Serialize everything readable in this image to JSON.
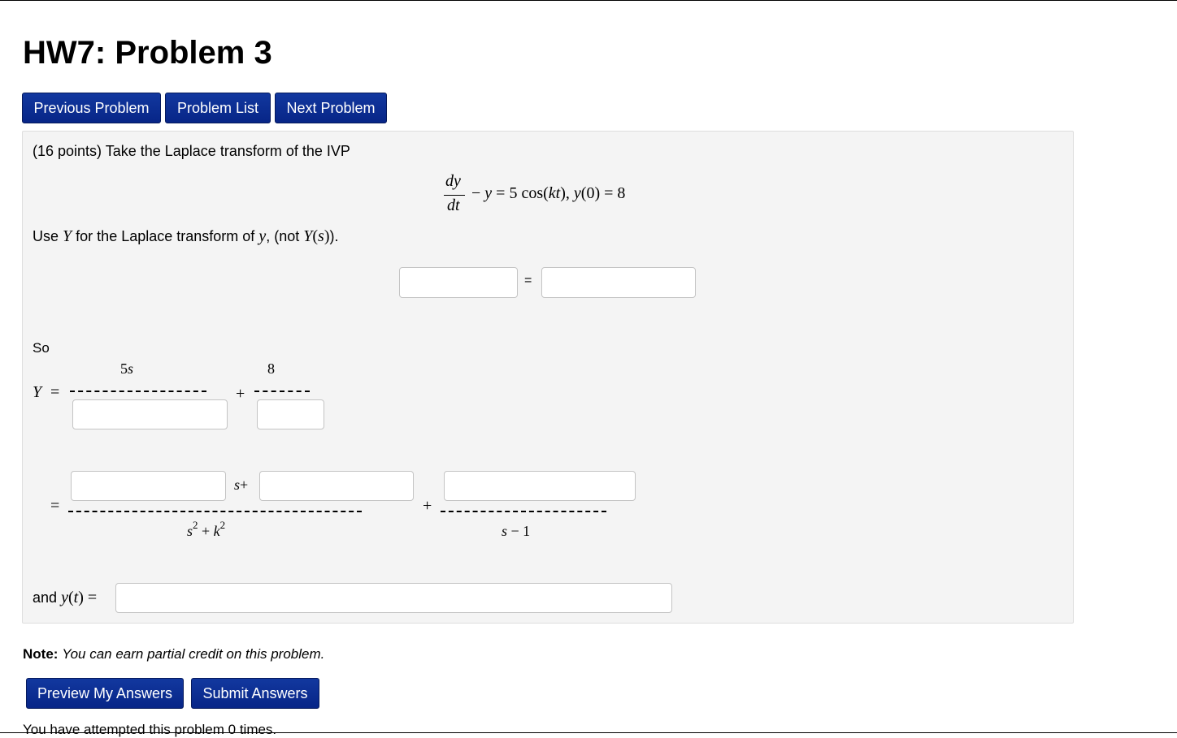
{
  "page": {
    "title": "HW7: Problem 3"
  },
  "nav": {
    "previous": "Previous Problem",
    "list": "Problem List",
    "next": "Next Problem"
  },
  "problem": {
    "intro": "(16 points) Take the Laplace transform of the IVP",
    "use_prefix": "Use",
    "use_mid": "for the Laplace transform of",
    "use_suffix": ", (not",
    "use_end": ").",
    "so_label": "So",
    "and_label": "and"
  },
  "note": {
    "label": "Note:",
    "text": "You can earn partial credit on this problem."
  },
  "actions": {
    "preview": "Preview My Answers",
    "submit": "Submit Answers"
  },
  "footer": {
    "attempts": "You have attempted this problem 0 times."
  }
}
